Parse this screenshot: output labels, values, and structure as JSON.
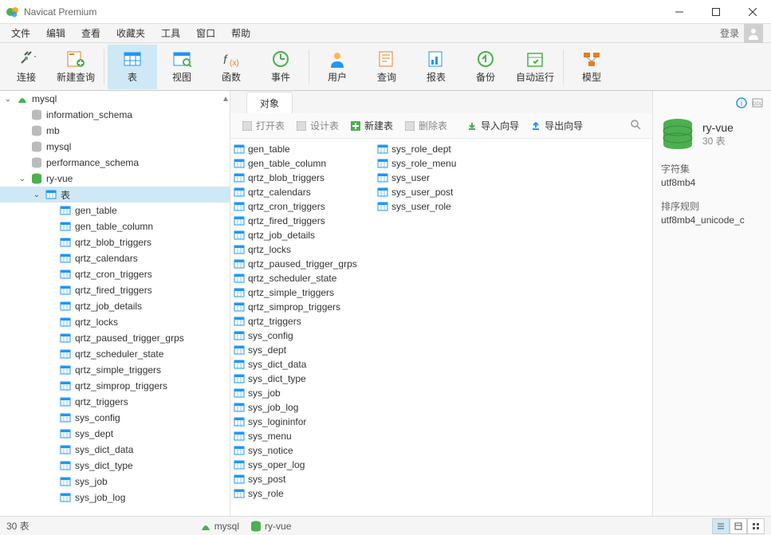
{
  "title": "Navicat Premium",
  "menu": [
    "文件",
    "编辑",
    "查看",
    "收藏夹",
    "工具",
    "窗口",
    "帮助"
  ],
  "login_label": "登录",
  "toolbar": [
    {
      "label": "连接",
      "icon": "plug"
    },
    {
      "label": "新建查询",
      "icon": "newquery"
    },
    {
      "label": "表",
      "icon": "table",
      "active": true
    },
    {
      "label": "视图",
      "icon": "view"
    },
    {
      "label": "函数",
      "icon": "fx"
    },
    {
      "label": "事件",
      "icon": "event"
    },
    {
      "label": "用户",
      "icon": "user"
    },
    {
      "label": "查询",
      "icon": "query"
    },
    {
      "label": "报表",
      "icon": "report"
    },
    {
      "label": "备份",
      "icon": "backup"
    },
    {
      "label": "自动运行",
      "icon": "schedule"
    },
    {
      "label": "模型",
      "icon": "model"
    }
  ],
  "tree": {
    "connection": "mysql",
    "databases": [
      "information_schema",
      "mb",
      "mysql",
      "performance_schema"
    ],
    "active_db": "ry-vue",
    "tables_node_label": "表",
    "tables": [
      "gen_table",
      "gen_table_column",
      "qrtz_blob_triggers",
      "qrtz_calendars",
      "qrtz_cron_triggers",
      "qrtz_fired_triggers",
      "qrtz_job_details",
      "qrtz_locks",
      "qrtz_paused_trigger_grps",
      "qrtz_scheduler_state",
      "qrtz_simple_triggers",
      "qrtz_simprop_triggers",
      "qrtz_triggers",
      "sys_config",
      "sys_dept",
      "sys_dict_data",
      "sys_dict_type",
      "sys_job",
      "sys_job_log"
    ]
  },
  "tab_label": "对象",
  "content_toolbar": {
    "open": "打开表",
    "design": "设计表",
    "new": "新建表",
    "delete": "删除表",
    "import": "导入向导",
    "export": "导出向导"
  },
  "content_tables_col1": [
    "gen_table",
    "gen_table_column",
    "qrtz_blob_triggers",
    "qrtz_calendars",
    "qrtz_cron_triggers",
    "qrtz_fired_triggers",
    "qrtz_job_details",
    "qrtz_locks",
    "qrtz_paused_trigger_grps",
    "qrtz_scheduler_state",
    "qrtz_simple_triggers",
    "qrtz_simprop_triggers",
    "qrtz_triggers",
    "sys_config",
    "sys_dept",
    "sys_dict_data",
    "sys_dict_type",
    "sys_job",
    "sys_job_log",
    "sys_logininfor",
    "sys_menu",
    "sys_notice",
    "sys_oper_log",
    "sys_post",
    "sys_role"
  ],
  "content_tables_col2": [
    "sys_role_dept",
    "sys_role_menu",
    "sys_user",
    "sys_user_post",
    "sys_user_role"
  ],
  "info": {
    "db_name": "ry-vue",
    "db_sub": "30 表",
    "charset_label": "字符集",
    "charset_value": "utf8mb4",
    "collation_label": "排序规则",
    "collation_value": "utf8mb4_unicode_c"
  },
  "status": {
    "count_label": "30 表",
    "conn": "mysql",
    "db": "ry-vue"
  }
}
